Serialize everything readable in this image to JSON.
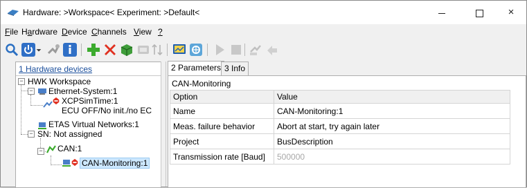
{
  "window": {
    "title": "Hardware: >Workspace<  Experiment: >Default<",
    "controls": {
      "minimize": "minimize-icon",
      "maximize": "maximize-icon",
      "close": "×"
    }
  },
  "menu": [
    {
      "label_u": "F",
      "label_rest": "ile"
    },
    {
      "label_pre": "H",
      "label_u": "a",
      "label_rest": "rdware"
    },
    {
      "label_u": "D",
      "label_rest": "evice"
    },
    {
      "label_u": "C",
      "label_rest": "hannels"
    },
    {
      "label_u": "V",
      "label_rest": "iew"
    },
    {
      "label_u": "?",
      "label_rest": ""
    }
  ],
  "toolbar_icons": [
    "search-icon",
    "power-icon",
    "hardware-config-icon",
    "info-icon",
    "add-icon",
    "delete-icon",
    "package-icon",
    "disabled-module-icon",
    "sort-icon",
    "monitor-icon",
    "network-icon",
    "play-icon",
    "stop-icon",
    "disabled-tool-icon",
    "disabled-back-icon"
  ],
  "left_pane": {
    "header": "1 Hardware devices",
    "tree": [
      {
        "label": "HWK Workspace"
      },
      {
        "label": "Ethernet-System:1"
      },
      {
        "label": "XCPSimTime:1",
        "sublabel": "ECU OFF/No init./no EC"
      },
      {
        "label": "ETAS Virtual Networks:1",
        "sublabel": "SN: Not assigned"
      },
      {
        "label": "CAN:1"
      },
      {
        "label": "CAN-Monitoring:1"
      }
    ]
  },
  "right_pane": {
    "tabs": [
      "2 Parameters",
      "3 Info"
    ],
    "section_title": "CAN-Monitoring",
    "columns": [
      "Option",
      "Value"
    ],
    "rows": [
      {
        "option": "Name",
        "value": "CAN-Monitoring:1"
      },
      {
        "option": "Meas. failure behavior",
        "value": "Abort at start, try again later"
      },
      {
        "option": "Project",
        "value": "BusDescription"
      },
      {
        "option": "Transmission rate [Baud]",
        "value": "500000"
      }
    ]
  },
  "colors": {
    "selection": "#cde8ff",
    "header_link": "#1b4f9c",
    "disabled_text": "#a8a8a8"
  }
}
